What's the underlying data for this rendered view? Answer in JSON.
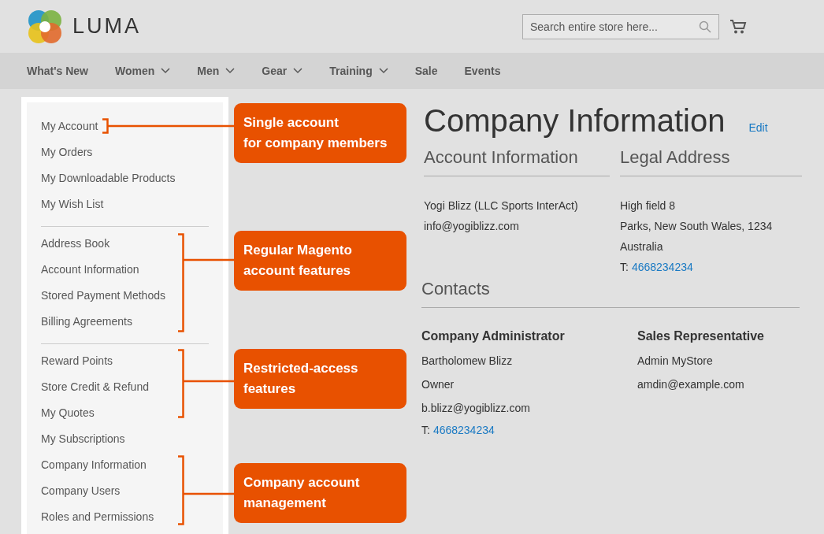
{
  "header": {
    "logo_text": "LUMA",
    "search": {
      "placeholder": "Search entire store here..."
    }
  },
  "nav": [
    {
      "label": "What's New",
      "has_dropdown": false
    },
    {
      "label": "Women",
      "has_dropdown": true
    },
    {
      "label": "Men",
      "has_dropdown": true
    },
    {
      "label": "Gear",
      "has_dropdown": true
    },
    {
      "label": "Training",
      "has_dropdown": true
    },
    {
      "label": "Sale",
      "has_dropdown": false
    },
    {
      "label": "Events",
      "has_dropdown": false
    }
  ],
  "sidebar": {
    "groups": [
      [
        "My Account",
        "My Orders",
        "My Downloadable Products",
        "My Wish List"
      ],
      [
        "Address Book",
        "Account Information",
        "Stored Payment Methods",
        "Billing Agreements"
      ],
      [
        "Reward Points",
        "Store Credit & Refund",
        "My Quotes",
        "My Subscriptions",
        "Company Information",
        "Company Users",
        "Roles and Permissions"
      ]
    ]
  },
  "annotations": [
    {
      "label": "Single account\nfor company members"
    },
    {
      "label": "Regular Magento\naccount features"
    },
    {
      "label": "Restricted-access\nfeatures"
    },
    {
      "label": "Company account\nmanagement"
    }
  ],
  "main": {
    "title": "Company Information",
    "edit_link": "Edit",
    "account_information": {
      "heading": "Account Information",
      "lines": [
        "Yogi Blizz (LLC Sports InterAct)",
        "info@yogiblizz.com"
      ]
    },
    "legal_address": {
      "heading": "Legal Address",
      "lines": [
        "High field 8",
        "Parks, New South Wales, 1234",
        "Australia"
      ],
      "phone_label": "T:",
      "phone": "4668234234"
    },
    "contacts": {
      "heading": "Contacts",
      "columns": [
        {
          "heading": "Company Administrator",
          "lines": [
            "Bartholomew Blizz",
            "Owner",
            "b.blizz@yogiblizz.com"
          ],
          "phone_label": "T:",
          "phone": "4668234234"
        },
        {
          "heading": "Sales Representative",
          "lines": [
            "Admin MyStore",
            "amdin@example.com"
          ]
        }
      ]
    }
  }
}
